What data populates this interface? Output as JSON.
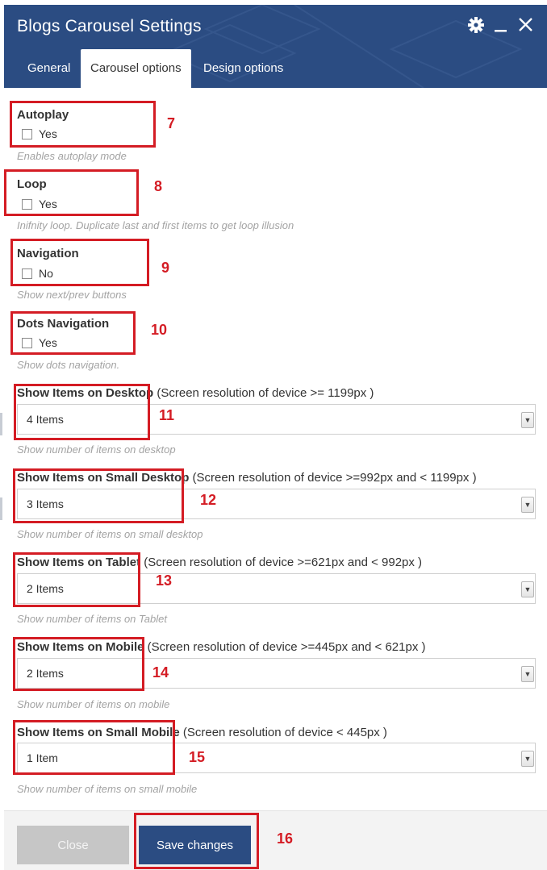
{
  "window": {
    "title": "Blogs Carousel Settings",
    "icons": [
      "gear-icon",
      "minimize-icon",
      "close-icon"
    ]
  },
  "tabs": [
    {
      "label": "General",
      "active": false
    },
    {
      "label": "Carousel options",
      "active": true
    },
    {
      "label": "Design options",
      "active": false
    }
  ],
  "fields": {
    "autoplay": {
      "label": "Autoplay",
      "option": "Yes",
      "checked": false,
      "help": "Enables autoplay mode"
    },
    "loop": {
      "label": "Loop",
      "option": "Yes",
      "checked": false,
      "help": "Inifnity loop. Duplicate last and first items to get loop illusion"
    },
    "navigation": {
      "label": "Navigation",
      "option": "No",
      "checked": false,
      "help": "Show next/prev buttons"
    },
    "dots": {
      "label": "Dots Navigation",
      "option": "Yes",
      "checked": false,
      "help": "Show dots navigation."
    },
    "desktop": {
      "label": "Show Items on Desktop",
      "detail": " (Screen resolution of device >= 1199px )",
      "value": "4 Items",
      "help": "Show number of items on desktop"
    },
    "small_desktop": {
      "label": "Show Items on Small Desktop",
      "detail": " (Screen resolution of device >=992px and < 1199px )",
      "value": "3 Items",
      "help": "Show number of items on small desktop"
    },
    "tablet": {
      "label": "Show Items on Tablet",
      "detail": " (Screen resolution of device >=621px and < 992px )",
      "value": "2 Items",
      "help": "Show number of items on Tablet"
    },
    "mobile": {
      "label": "Show Items on Mobile",
      "detail": " (Screen resolution of device >=445px and < 621px )",
      "value": "2 Items",
      "help": "Show number of items on mobile"
    },
    "small_mobile": {
      "label": "Show Items on Small Mobile",
      "detail": " (Screen resolution of device < 445px )",
      "value": "1 Item",
      "help": "Show number of items on small mobile"
    }
  },
  "annotations": [
    "7",
    "8",
    "9",
    "10",
    "11",
    "12",
    "13",
    "14",
    "15",
    "16"
  ],
  "footer": {
    "close_label": "Close",
    "save_label": "Save changes"
  },
  "colors": {
    "header": "#2b4c82",
    "annotation": "#d41c24",
    "save_button": "#2b4c82",
    "close_button": "#c6c6c6"
  }
}
